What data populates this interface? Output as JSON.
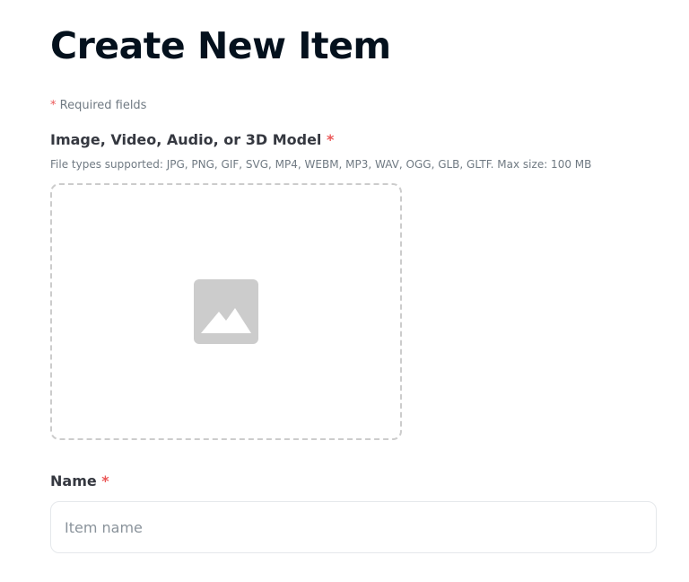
{
  "page": {
    "title": "Create New Item",
    "required_asterisk": "*",
    "required_note": "Required fields"
  },
  "media_field": {
    "label": "Image, Video, Audio, or 3D Model",
    "required_mark": "*",
    "file_types": "File types supported: JPG, PNG, GIF, SVG, MP4, WEBM, MP3, WAV, OGG, GLB, GLTF. Max size: 100 MB",
    "icon": "image-placeholder-icon"
  },
  "name_field": {
    "label": "Name",
    "required_mark": "*",
    "placeholder": "Item name",
    "value": ""
  },
  "colors": {
    "text_primary": "#04111d",
    "text_label": "#353840",
    "text_muted": "#707a83",
    "required": "#eb5757",
    "dropzone_border": "#cccccc",
    "icon_fill": "#cccccc",
    "input_border": "#e5e8eb"
  }
}
